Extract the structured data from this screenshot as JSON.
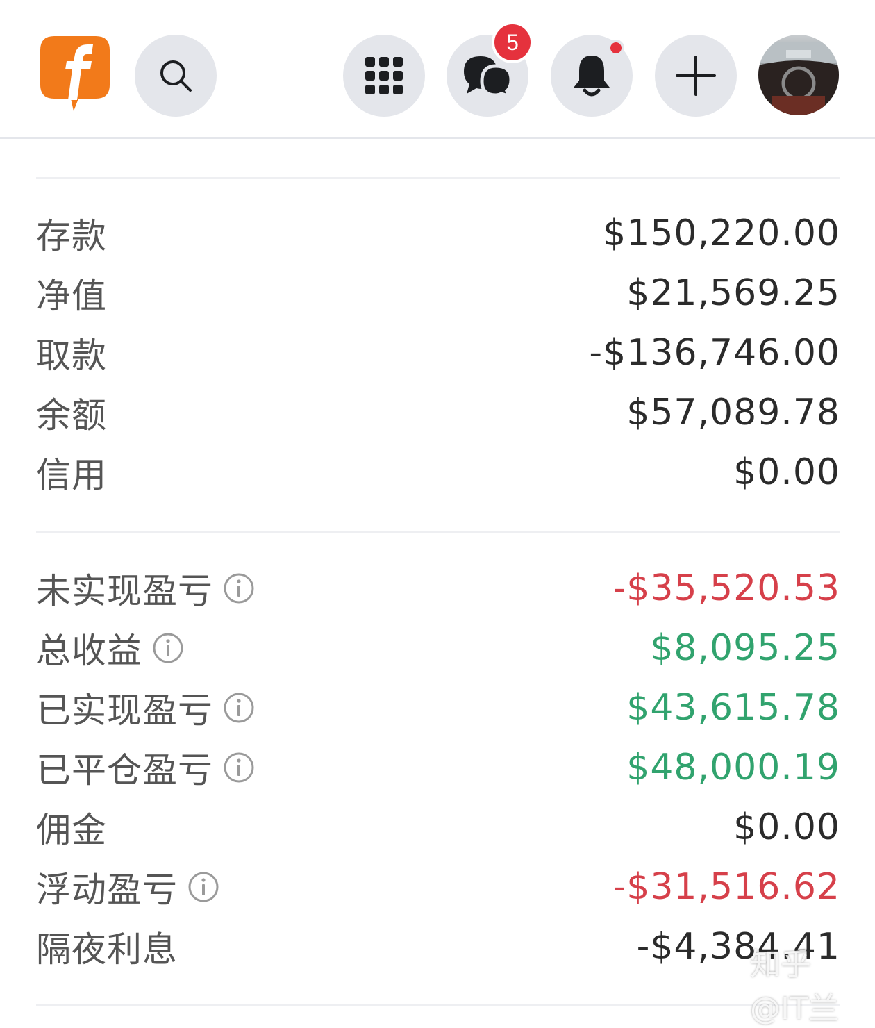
{
  "header": {
    "logo_icon": "facebook-logo-icon",
    "search_icon": "search-icon",
    "apps_icon": "grid-menu-icon",
    "chat_icon": "messages-icon",
    "chat_badge": "5",
    "bell_icon": "bell-icon",
    "plus_icon": "plus-icon",
    "avatar_icon": "profile-avatar"
  },
  "account": {
    "rows": [
      {
        "label": "存款",
        "value": "$150,220.00"
      },
      {
        "label": "净值",
        "value": "$21,569.25"
      },
      {
        "label": "取款",
        "value": "-$136,746.00"
      },
      {
        "label": "余额",
        "value": "$57,089.78"
      },
      {
        "label": "信用",
        "value": "$0.00"
      }
    ]
  },
  "pnl": {
    "rows": [
      {
        "label": "未实现盈亏",
        "value": "-$35,520.53",
        "color": "#d6404a",
        "info": true
      },
      {
        "label": "总收益",
        "value": "$8,095.25",
        "color": "#31a36e",
        "info": true
      },
      {
        "label": "已实现盈亏",
        "value": "$43,615.78",
        "color": "#31a36e",
        "info": true
      },
      {
        "label": "已平仓盈亏",
        "value": "$48,000.19",
        "color": "#31a36e",
        "info": true
      },
      {
        "label": "佣金",
        "value": "$0.00",
        "info": false
      },
      {
        "label": "浮动盈亏",
        "value": "-$31,516.62",
        "color": "#d6404a",
        "info": true
      },
      {
        "label": "隔夜利息",
        "value": "-$4,384.41",
        "info": false
      }
    ]
  },
  "watermark": "知乎 @IT兰"
}
